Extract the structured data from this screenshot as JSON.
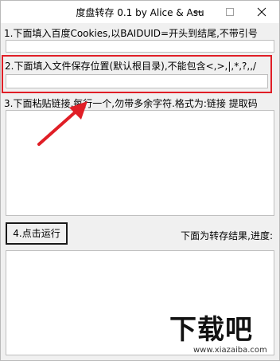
{
  "window": {
    "title": "度盘转存 0.1 by Alice & Asu"
  },
  "form": {
    "cookies_label": "1.下面填入百度Cookies,以BAIDUID=开头到结尾,不带引号",
    "cookies_value": "",
    "folder_label": "2.下面填入文件保存位置(默认根目录),不能包含<,>,|,*,?,,/",
    "folder_value": "",
    "links_label": "3.下面粘贴链接,每行一个,勿带多余字符.格式为:链接 提取码",
    "links_value": "",
    "run_button": "4.点击运行",
    "results_label": "下面为转存结果,进度:",
    "results_value": ""
  },
  "annotation": {
    "highlight_color": "#e01e26"
  },
  "watermark": {
    "logo_text": "下载吧",
    "url": "www.xiazaiba.com"
  }
}
